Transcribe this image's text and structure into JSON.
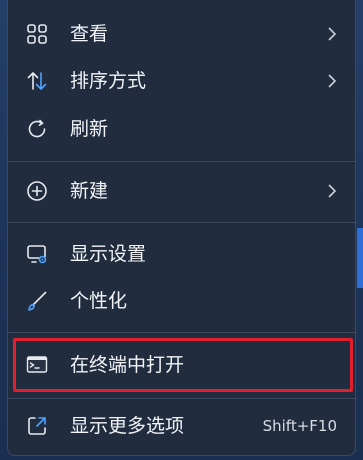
{
  "context_menu": {
    "items": [
      {
        "id": "view",
        "label": "查看",
        "icon": "grid-icon",
        "has_submenu": true
      },
      {
        "id": "sort",
        "label": "排序方式",
        "icon": "sort-arrows-icon",
        "has_submenu": true
      },
      {
        "id": "refresh",
        "label": "刷新",
        "icon": "refresh-icon",
        "has_submenu": false
      },
      {
        "id": "new",
        "label": "新建",
        "icon": "plus-circle-icon",
        "has_submenu": true
      },
      {
        "id": "display",
        "label": "显示设置",
        "icon": "display-settings-icon",
        "has_submenu": false
      },
      {
        "id": "personalize",
        "label": "个性化",
        "icon": "brush-icon",
        "has_submenu": false
      },
      {
        "id": "terminal",
        "label": "在终端中打开",
        "icon": "terminal-icon",
        "has_submenu": false,
        "highlighted": true
      },
      {
        "id": "more",
        "label": "显示更多选项",
        "icon": "share-more-icon",
        "has_submenu": false,
        "shortcut": "Shift+F10"
      }
    ]
  },
  "colors": {
    "menu_background": "#212c3f",
    "highlight_border": "#e0202c",
    "accent": "#4aa3ff",
    "text": "#f2f4f8"
  }
}
